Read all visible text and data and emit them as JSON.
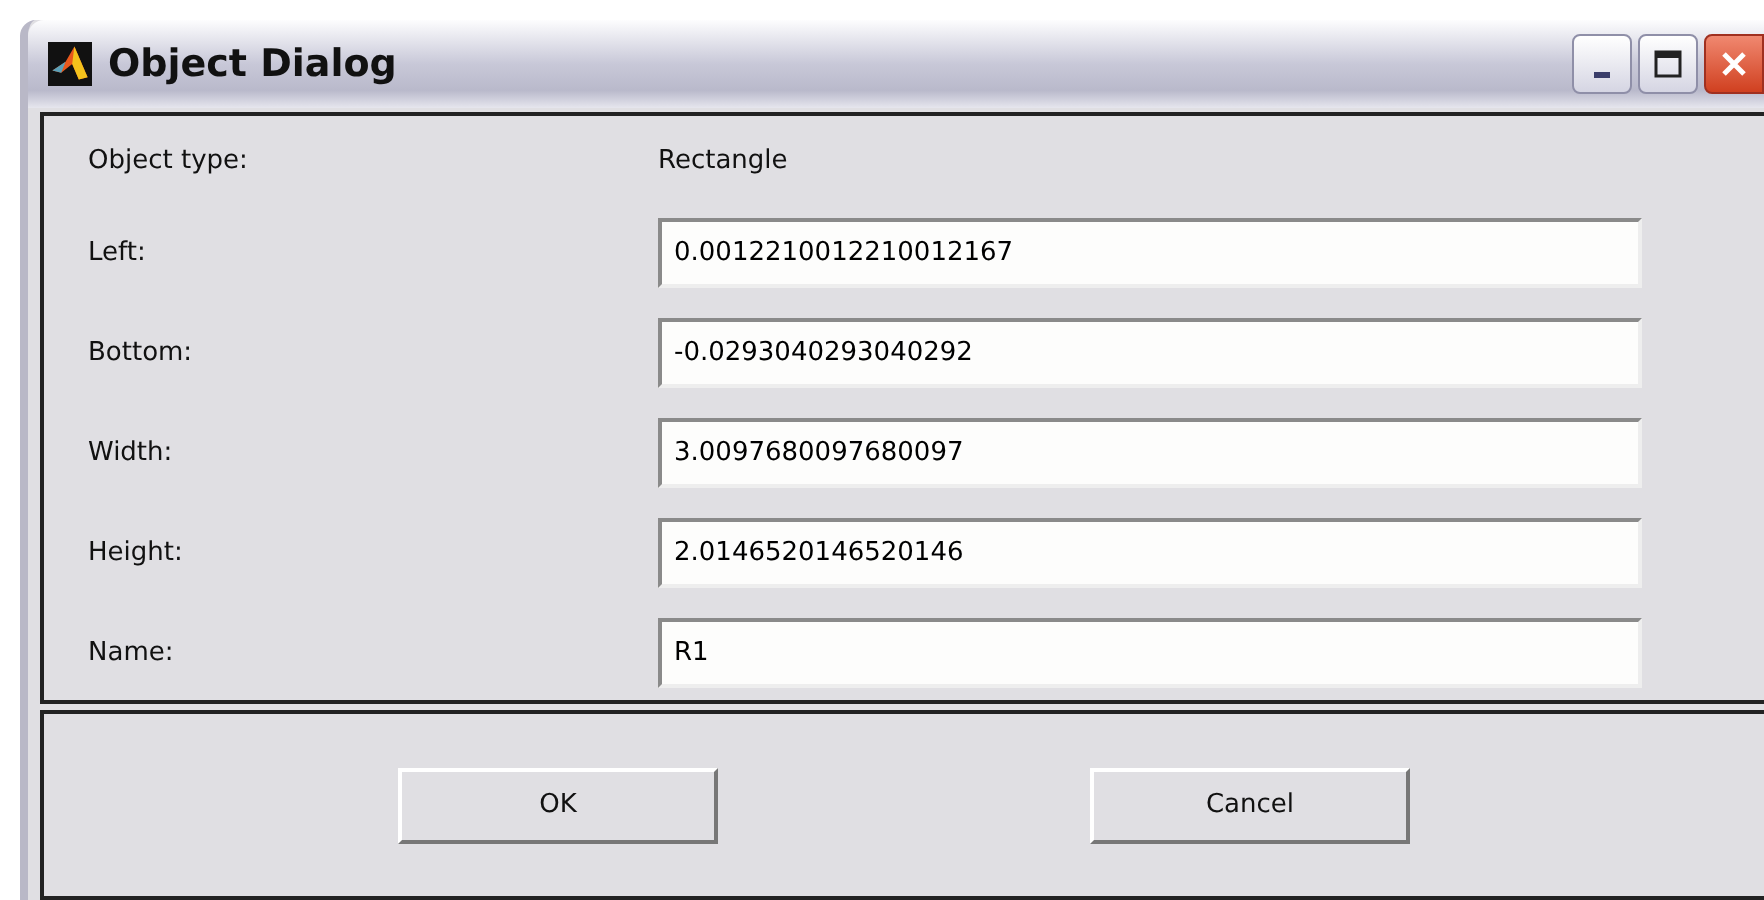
{
  "window": {
    "title": "Object Dialog"
  },
  "type_row": {
    "label": "Object type:",
    "value": "Rectangle"
  },
  "fields": [
    {
      "label": "Left:",
      "value": "0.0012210012210012167"
    },
    {
      "label": "Bottom:",
      "value": "-0.0293040293040292"
    },
    {
      "label": "Width:",
      "value": "3.0097680097680097"
    },
    {
      "label": "Height:",
      "value": "2.0146520146520146"
    },
    {
      "label": "Name:",
      "value": "R1"
    }
  ],
  "buttons": [
    "OK",
    "Cancel"
  ]
}
